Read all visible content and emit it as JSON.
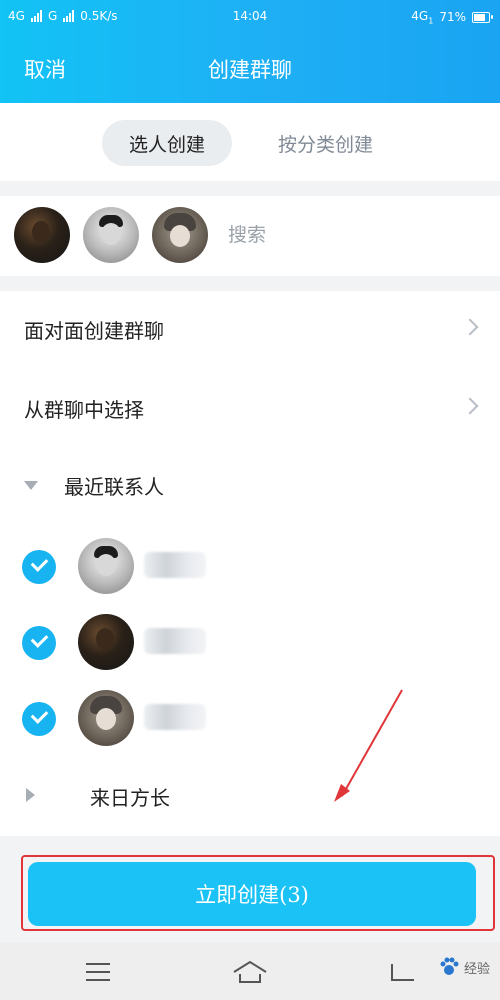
{
  "status_bar": {
    "left_network_1": "4G",
    "left_network_2": "G",
    "speed": "0.5K/s",
    "time": "14:04",
    "right_network": "4G",
    "right_network_sub": "1",
    "battery": "71%"
  },
  "header": {
    "cancel_label": "取消",
    "title": "创建群聊"
  },
  "tabs": [
    {
      "label": "选人创建",
      "active": true
    },
    {
      "label": "按分类创建",
      "active": false
    }
  ],
  "search": {
    "placeholder": "搜索"
  },
  "list": {
    "face_to_face": "面对面创建群聊",
    "from_group": "从群聊中选择"
  },
  "sections": {
    "recent": "最近联系人",
    "collapsed": "来日方长"
  },
  "create_button": {
    "label": "立即创建(3)"
  },
  "watermark": {
    "text": "经验"
  },
  "colors": {
    "header_gradient_start": "#12c3f5",
    "header_gradient_end": "#1aa4f2",
    "accent": "#1bc2f6",
    "check": "#18b4f2",
    "highlight_frame": "#e0363a"
  }
}
